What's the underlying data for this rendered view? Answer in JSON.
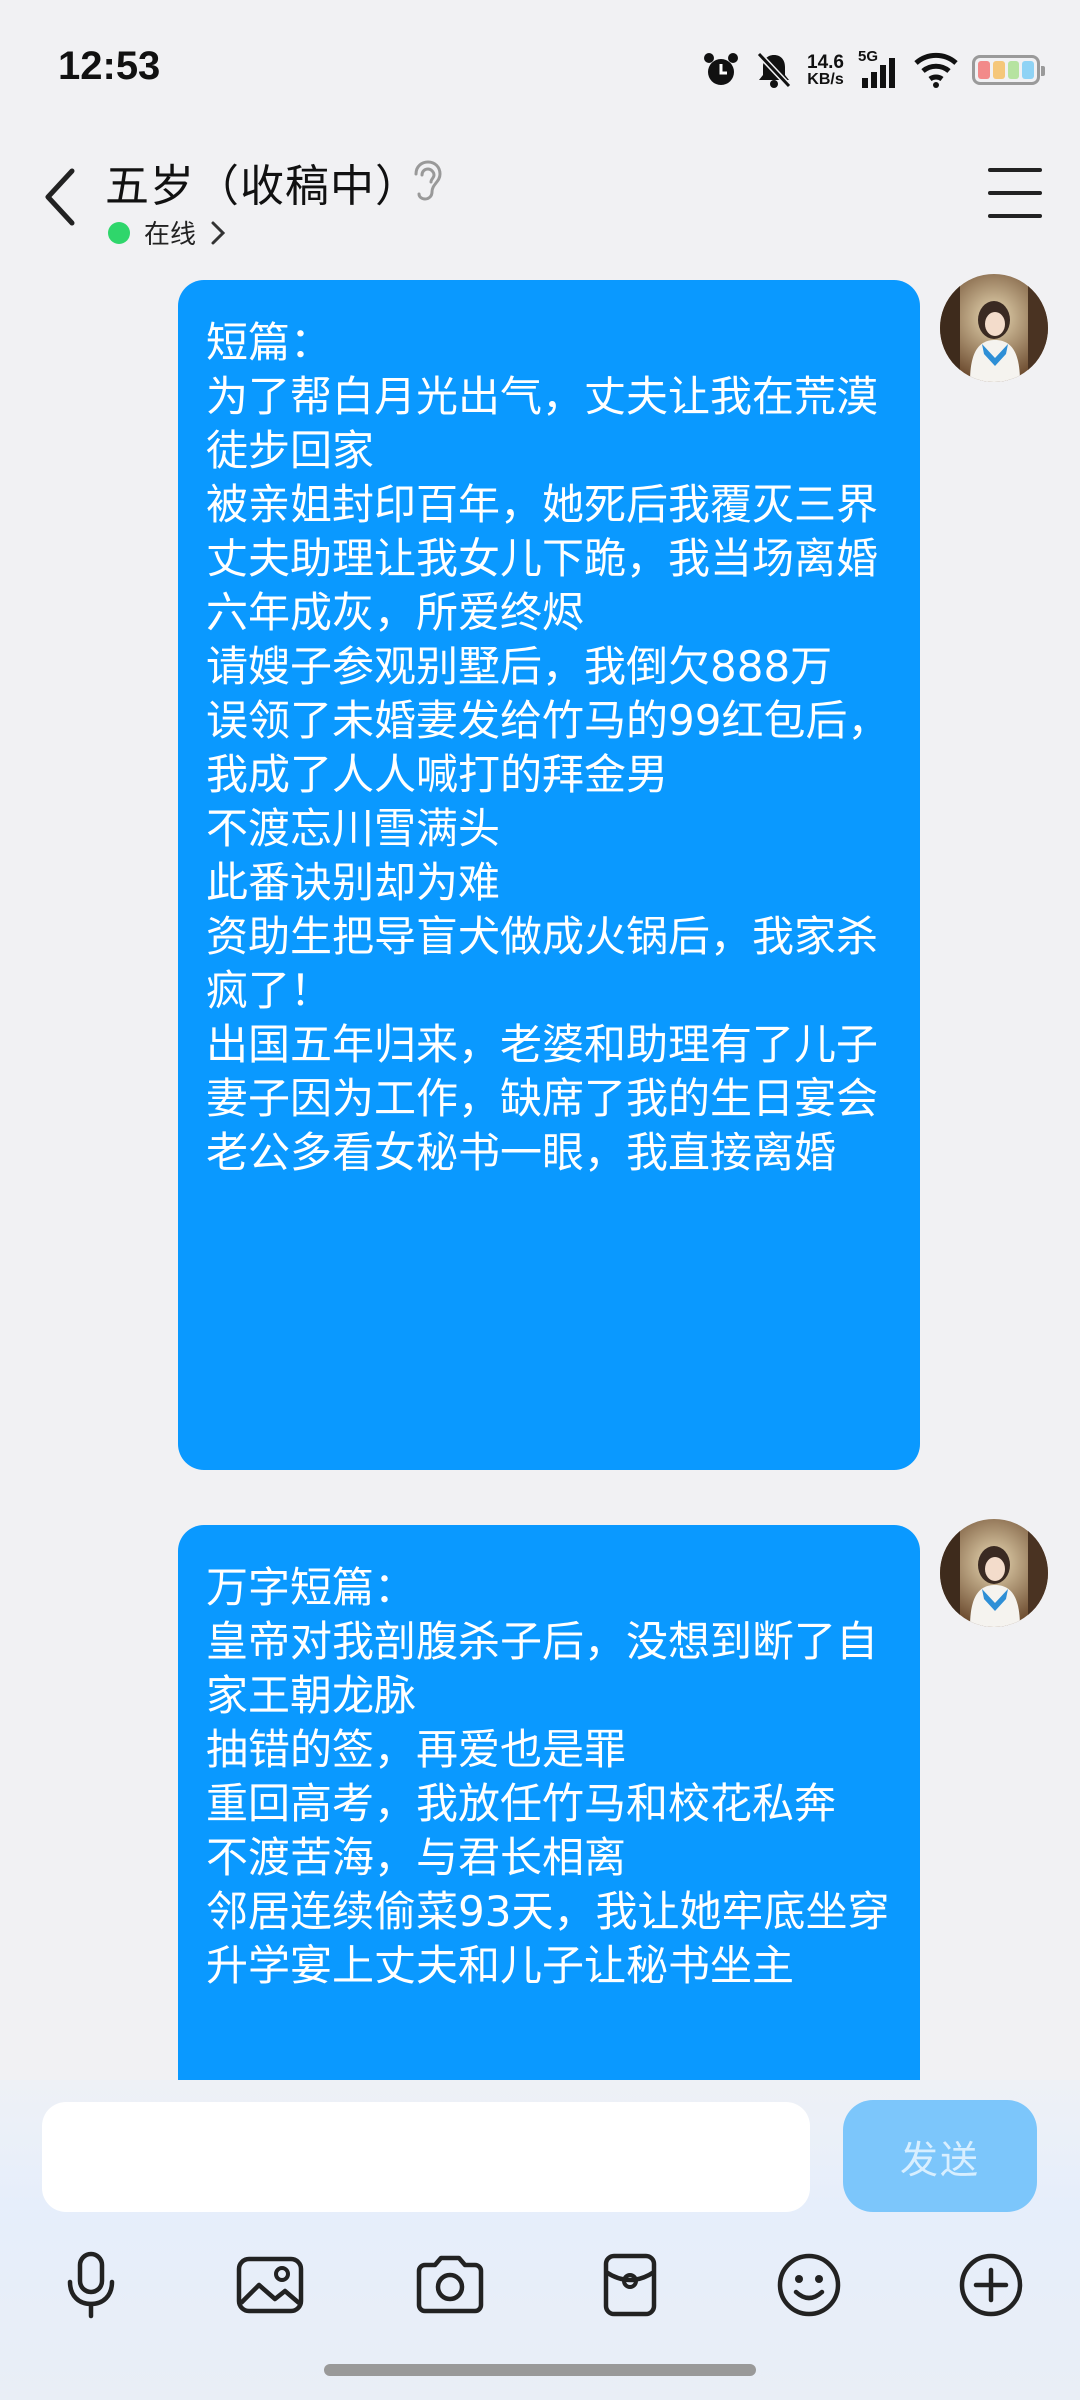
{
  "status_bar": {
    "time": "12:53",
    "net_speed_value": "14.6",
    "net_speed_unit": "KB/s",
    "network_label": "5G",
    "icons": [
      "alarm-icon",
      "mute-bell-icon",
      "signal-icon",
      "wifi-icon",
      "battery-icon"
    ],
    "battery_colors": [
      "#f28a8a",
      "#f5c77a",
      "#b6e3a0",
      "#8fd3f5"
    ]
  },
  "header": {
    "contact_name": "五岁（收稿中）",
    "status_text": "在线",
    "status_color": "#2fd66b",
    "icons": [
      "back-arrow-icon",
      "ear-icon",
      "chevron-right-icon",
      "menu-icon"
    ]
  },
  "messages": [
    {
      "lines": [
        "短篇：",
        "为了帮白月光出气，丈夫让我在荒漠徒步回家",
        "被亲姐封印百年，她死后我覆灭三界",
        "丈夫助理让我女儿下跪，我当场离婚",
        "六年成灰，所爱终烬",
        "请嫂子参观别墅后，我倒欠888万",
        "误领了未婚妻发给竹马的99红包后，我成了人人喊打的拜金男",
        "不渡忘川雪满头",
        "此番诀别却为难",
        "资助生把导盲犬做成火锅后，我家杀疯了！",
        "出国五年归来，老婆和助理有了儿子",
        "妻子因为工作，缺席了我的生日宴会",
        "老公多看女秘书一眼，我直接离婚"
      ]
    },
    {
      "lines": [
        "万字短篇：",
        "皇帝对我剖腹杀子后，没想到断了自家王朝龙脉",
        "抽错的签，再爱也是罪",
        "重回高考，我放任竹马和校花私奔",
        "不渡苦海，与君长相离",
        "邻居连续偷菜93天，我让她牢底坐穿",
        "升学宴上丈夫和儿子让秘书坐主"
      ]
    }
  ],
  "composer": {
    "input_value": "",
    "send_label": "发送"
  },
  "toolbar": {
    "items": [
      "microphone-icon",
      "image-icon",
      "camera-icon",
      "red-packet-icon",
      "emoji-icon",
      "plus-icon"
    ]
  },
  "colors": {
    "bubble": "#0a99ff",
    "send_button": "#7cc6fb",
    "background": "#f1f1f3"
  }
}
